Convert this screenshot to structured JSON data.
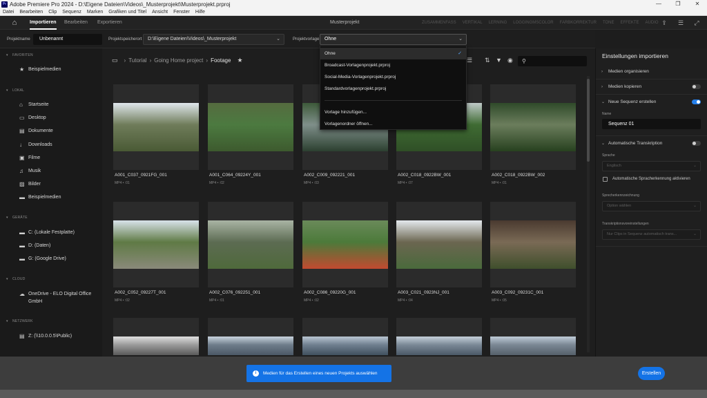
{
  "window": {
    "title": "Adobe Premiere Pro 2024 - D:\\Eigene Dateien\\Videos\\_Musterprojekt\\Musterprojekt.prproj",
    "app_badge": "Pr"
  },
  "menu": [
    "Datei",
    "Bearbeiten",
    "Clip",
    "Sequenz",
    "Marken",
    "Grafiken und Titel",
    "Ansicht",
    "Fenster",
    "Hilfe"
  ],
  "header": {
    "tabs": [
      "Importieren",
      "Bearbeiten",
      "Exportieren"
    ],
    "active_tab": "Importieren",
    "project_title": "Musterprojekt",
    "workspaces": [
      "ZUSAMMENFASS",
      "VERTIKAL",
      "LERNING",
      "LOGGINGMSCOLOR",
      "FARBKORREKTUR",
      "TONE",
      "EFFEKTE",
      "AUDIO",
      "GRAFIKEN"
    ]
  },
  "toolbar": {
    "project_name_label": "Projektname",
    "project_name_value": "Unbenannt",
    "location_label": "Projektspeicherort",
    "location_value": "D:\\Eigene Dateien\\Videos\\_Musterprojekt",
    "template_label": "Projektvorlage",
    "template_value": "Ohne"
  },
  "sidebar": {
    "favorites_title": "FAVORITEN",
    "favorites": [
      {
        "label": "Beispielmedien",
        "icon": "star-icon"
      }
    ],
    "local_title": "LOKAL",
    "local": [
      {
        "label": "Startseite",
        "icon": "home-icon"
      },
      {
        "label": "Desktop",
        "icon": "desktop-icon"
      },
      {
        "label": "Dokumente",
        "icon": "document-icon"
      },
      {
        "label": "Downloads",
        "icon": "download-icon"
      },
      {
        "label": "Filme",
        "icon": "film-icon"
      },
      {
        "label": "Musik",
        "icon": "music-icon"
      },
      {
        "label": "Bilder",
        "icon": "image-icon"
      },
      {
        "label": "Beispielmedien",
        "icon": "folder-icon"
      }
    ],
    "devices_title": "GERÄTE",
    "devices": [
      {
        "label": "C: (Lokale Festplatte)",
        "icon": "folder-icon"
      },
      {
        "label": "D: (Daten)",
        "icon": "folder-icon"
      },
      {
        "label": "G: (Google Drive)",
        "icon": "folder-icon"
      }
    ],
    "cloud_title": "CLOUD",
    "cloud": [
      {
        "label_line1": "OneDrive - ELO Digital Office",
        "label_line2": "GmbH",
        "icon": "cloud-icon"
      }
    ],
    "network_title": "NETZWERK",
    "network": [
      {
        "label": "Z: (\\\\10.0.0.5\\Public)",
        "icon": "server-icon"
      }
    ]
  },
  "breadcrumbs": [
    "Tutorial",
    "Going Home project",
    "Footage"
  ],
  "media": [
    {
      "name": "A001_C037_0921FG_001",
      "meta": "MP4 • :01",
      "c1": "#dfe6ec",
      "c2": "#6f7c5a",
      "c3": "#4a5a35"
    },
    {
      "name": "A001_C064_09224Y_001",
      "meta": "MP4 • :02",
      "c1": "#556b3f",
      "c2": "#4c7a40",
      "c3": "#3d5a2e"
    },
    {
      "name": "A002_C009_092221_001",
      "meta": "MP4 • :03",
      "c1": "#3e5a3a",
      "c2": "#7f8f8a",
      "c3": "#2c4030"
    },
    {
      "name": "A002_C018_0922BW_001",
      "meta": "MP4 • :07",
      "c1": "#bfc9c8",
      "c2": "#3f6b33",
      "c3": "#2f4f26"
    },
    {
      "name": "A002_C018_0922BW_002",
      "meta": "MP4 • :01",
      "c1": "#2f4a2a",
      "c2": "#6b7d5c",
      "c3": "#27411f"
    },
    {
      "name": "A002_C052_09227T_001",
      "meta": "MP4 • :02",
      "c1": "#d8e2ea",
      "c2": "#5f7a45",
      "c3": "#8a8a7a"
    },
    {
      "name": "A002_C076_092251_001",
      "meta": "MP4 • :01",
      "c1": "#a9b4a4",
      "c2": "#5c6b52",
      "c3": "#4f6a3b"
    },
    {
      "name": "A002_C086_09220G_001",
      "meta": "MP4 • :02",
      "c1": "#6a8a5a",
      "c2": "#4c7a3a",
      "c3": "#c24a30"
    },
    {
      "name": "A003_C021_0923NJ_001",
      "meta": "MP4 • :04",
      "c1": "#e4e9ee",
      "c2": "#6b6650",
      "c3": "#4a6a3c"
    },
    {
      "name": "A003_C092_09231C_001",
      "meta": "MP4 • :05",
      "c1": "#4a3a30",
      "c2": "#7a6a55",
      "c3": "#3f4f2c"
    },
    {
      "name": "",
      "meta": "",
      "c1": "#e0e0e0",
      "c2": "#9a9a9a",
      "c3": "#5a5a5a"
    },
    {
      "name": "",
      "meta": "",
      "c1": "#c9d4de",
      "c2": "#6e7c8a",
      "c3": "#4b5866"
    },
    {
      "name": "",
      "meta": "",
      "c1": "#b9c6d3",
      "c2": "#6f7f8f",
      "c3": "#40505e"
    },
    {
      "name": "",
      "meta": "",
      "c1": "#c5d0da",
      "c2": "#7a8896",
      "c3": "#4a5866"
    },
    {
      "name": "",
      "meta": "",
      "c1": "#c0ccd8",
      "c2": "#7a8794",
      "c3": "#55606a"
    }
  ],
  "dropdown": {
    "items": [
      "Ohne",
      "Broadcast-Vorlagenprojekt.prproj",
      "Social-Media-Vorlagenprojekt.prproj",
      "Standardvorlagenprojekt.prproj"
    ],
    "selected": "Ohne",
    "actions": [
      "Vorlage hinzufügen...",
      "Vorlagenordner öffnen..."
    ]
  },
  "right_panel": {
    "title": "Einstellungen importieren",
    "organize": "Medien organisieren",
    "copy": "Medien kopieren",
    "new_sequence": "Neue Sequenz erstellen",
    "name_label": "Name",
    "sequence_name": "Sequenz 01",
    "auto_transcript": "Automatische Transkription",
    "language_label": "Sprache",
    "language_value": "Englisch",
    "auto_detect": "Automatische Spracherkennung aktivieren",
    "speaker_label": "Sprecherkennzeichnung",
    "speaker_value": "Option wählen",
    "preset_label": "Transkriptionsvoreinstellungen",
    "preset_value": "Nur Clips in Sequenz automatisch trans..."
  },
  "footer": {
    "toast": "Medien für das Erstellen eines neuen Projekts auswählen",
    "create": "Erstellen"
  }
}
